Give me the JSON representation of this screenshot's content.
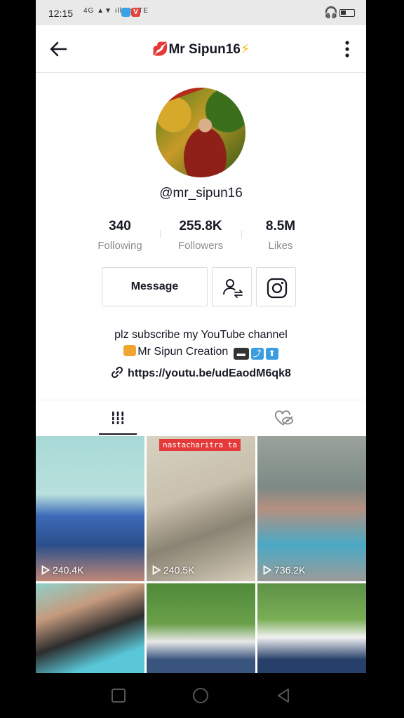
{
  "status": {
    "time": "12:15",
    "signal": "4G ▲▼ ıll VoLTE"
  },
  "header": {
    "lips_emoji": "💋",
    "title": "Mr Sipun16",
    "bolt_emoji": "⚡"
  },
  "profile": {
    "username": "@mr_sipun16"
  },
  "stats": [
    {
      "value": "340",
      "label": "Following"
    },
    {
      "value": "255.8K",
      "label": "Followers"
    },
    {
      "value": "8.5M",
      "label": "Likes"
    }
  ],
  "actions": {
    "message_label": "Message"
  },
  "bio": {
    "line1": "plz subscribe my YouTube channel",
    "line2": "Mr Sipun Creation",
    "link": "https://youtu.be/udEaodM6qk8"
  },
  "videos": [
    {
      "views": "240.4K"
    },
    {
      "views": "240.5K",
      "tag": "nastacharitra ta"
    },
    {
      "views": "736.2K"
    },
    {
      "views": ""
    },
    {
      "views": ""
    },
    {
      "views": ""
    }
  ],
  "colors": {
    "text": "#161823",
    "secondary": "#8a8b91",
    "accent_red": "#e53a3a"
  },
  "icons": {
    "back": "arrow-left-icon",
    "more": "vertical-dots-icon",
    "add_friend": "person-swap-icon",
    "instagram": "instagram-icon",
    "link": "chain-link-icon",
    "grid_tab": "grid-icon",
    "liked_tab": "heart-eye-icon",
    "play": "play-icon"
  }
}
